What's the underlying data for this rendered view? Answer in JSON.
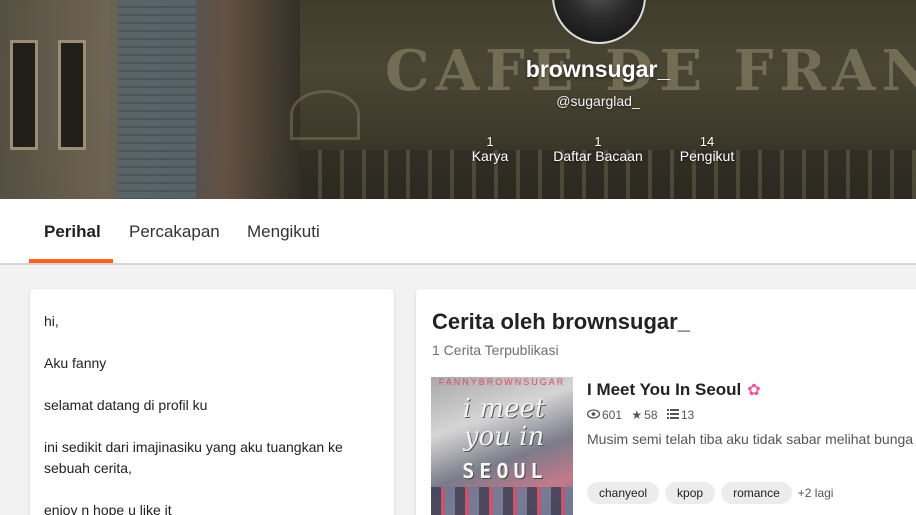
{
  "profile": {
    "username": "brownsugar_",
    "handle": "@sugarglad_",
    "banner_sign": "CAFE DE FRAN",
    "stats": [
      {
        "value": "1",
        "label": "Karya"
      },
      {
        "value": "1",
        "label": "Daftar Bacaan"
      },
      {
        "value": "14",
        "label": "Pengikut"
      }
    ]
  },
  "tabs": [
    {
      "label": "Perihal",
      "active": true
    },
    {
      "label": "Percakapan",
      "active": false
    },
    {
      "label": "Mengikuti",
      "active": false
    }
  ],
  "about": {
    "paragraphs": [
      "hi,",
      "Aku fanny",
      "selamat datang di profil ku",
      "ini sedikit dari imajinasiku yang aku tuangkan ke sebuah cerita,",
      "enjoy n hope u like it"
    ]
  },
  "stories": {
    "title": "Cerita oleh brownsugar_",
    "count_label": "1 Cerita Terpublikasi",
    "items": [
      {
        "title": "I Meet You In Seoul",
        "title_icon": "tulip-icon",
        "reads": "601",
        "votes": "58",
        "parts": "13",
        "description": "Musim semi telah tiba aku tidak sabar melihat bunga",
        "cover": {
          "top_text": "FANNYBROWNSUGAR",
          "title": "i meet you in",
          "city": "SEOUL"
        },
        "tags": [
          "chanyeol",
          "kpop",
          "romance"
        ],
        "more_tags": "+2 lagi"
      }
    ]
  },
  "colors": {
    "accent": "#ff6122",
    "tag_bg": "#ececec",
    "muted_text": "#6f6f6f"
  }
}
